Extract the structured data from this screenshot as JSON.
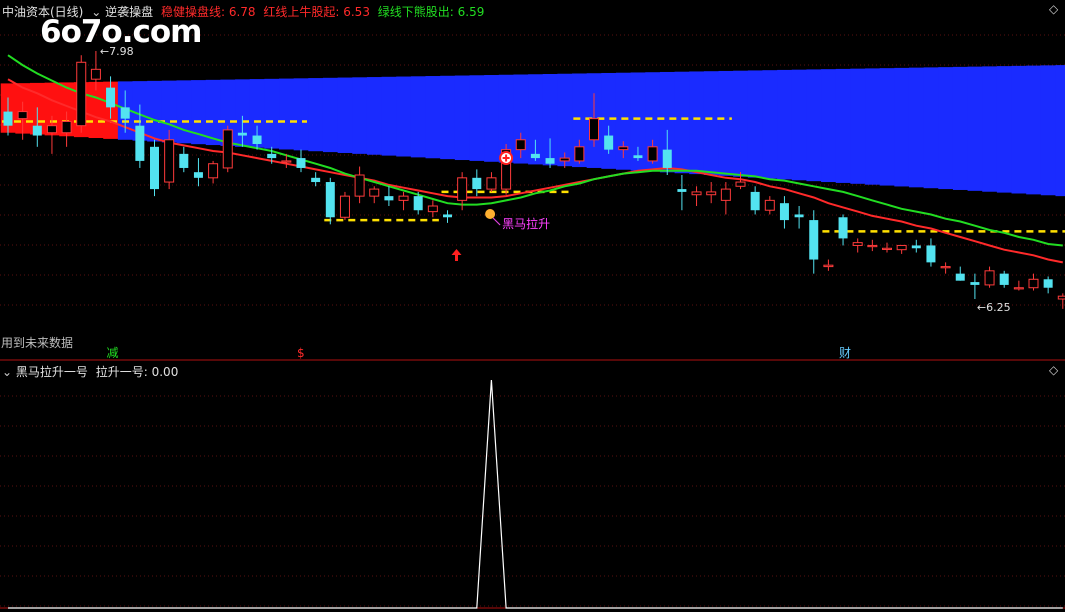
{
  "watermark": "6o7o.com",
  "main_panel": {
    "title": "中油资本(日线)",
    "indicator": "逆袭操盘",
    "lines": [
      {
        "label": "稳健操盘线:",
        "value": "6.78",
        "color": "#ff2a2a"
      },
      {
        "label": "红线上牛股起:",
        "value": "6.53",
        "color": "#ff2a2a"
      },
      {
        "label": "绿线下熊股出:",
        "value": "6.59",
        "color": "#22dd22"
      }
    ],
    "future_data_note": "用到未来数据",
    "marker_label": "黑马拉升",
    "high_label": "7.98",
    "low_label": "6.25",
    "badges": [
      {
        "text": "减",
        "color": "#22dd22"
      },
      {
        "text": "$",
        "color": "#ff2a2a"
      },
      {
        "text": "财",
        "color": "#66ccff"
      }
    ]
  },
  "sub_panel": {
    "indicator": "黑马拉升一号",
    "line_label": "拉升一号:",
    "line_value": "0.00"
  },
  "chart_data": {
    "type": "candlestick",
    "title": "中油资本(日线)",
    "price_range": [
      6.0,
      8.2
    ],
    "ohlc": [
      [
        7.55,
        7.65,
        7.38,
        7.45
      ],
      [
        7.5,
        7.62,
        7.35,
        7.55
      ],
      [
        7.45,
        7.58,
        7.3,
        7.38
      ],
      [
        7.4,
        7.52,
        7.25,
        7.45
      ],
      [
        7.4,
        7.55,
        7.3,
        7.48
      ],
      [
        7.45,
        7.95,
        7.4,
        7.9
      ],
      [
        7.78,
        7.98,
        7.7,
        7.85
      ],
      [
        7.72,
        7.8,
        7.5,
        7.58
      ],
      [
        7.58,
        7.7,
        7.4,
        7.5
      ],
      [
        7.45,
        7.6,
        7.15,
        7.2
      ],
      [
        7.3,
        7.35,
        6.95,
        7.0
      ],
      [
        7.05,
        7.42,
        7.0,
        7.35
      ],
      [
        7.25,
        7.3,
        7.12,
        7.15
      ],
      [
        7.12,
        7.22,
        7.02,
        7.08
      ],
      [
        7.08,
        7.2,
        7.04,
        7.18
      ],
      [
        7.15,
        7.45,
        7.12,
        7.42
      ],
      [
        7.4,
        7.52,
        7.3,
        7.38
      ],
      [
        7.38,
        7.45,
        7.28,
        7.32
      ],
      [
        7.25,
        7.3,
        7.18,
        7.22
      ],
      [
        7.2,
        7.25,
        7.15,
        7.2
      ],
      [
        7.22,
        7.28,
        7.12,
        7.15
      ],
      [
        7.08,
        7.12,
        7.02,
        7.05
      ],
      [
        7.05,
        7.08,
        6.75,
        6.8
      ],
      [
        6.8,
        6.98,
        6.78,
        6.95
      ],
      [
        6.95,
        7.16,
        6.9,
        7.1
      ],
      [
        6.95,
        7.02,
        6.9,
        7.0
      ],
      [
        6.95,
        7.02,
        6.88,
        6.92
      ],
      [
        6.92,
        6.98,
        6.85,
        6.95
      ],
      [
        6.95,
        6.98,
        6.82,
        6.85
      ],
      [
        6.84,
        6.92,
        6.8,
        6.88
      ],
      [
        6.82,
        6.85,
        6.76,
        6.8
      ],
      [
        6.92,
        7.12,
        6.85,
        7.08
      ],
      [
        7.08,
        7.14,
        6.95,
        7.0
      ],
      [
        7.0,
        7.12,
        6.98,
        7.08
      ],
      [
        7.0,
        7.32,
        6.96,
        7.28
      ],
      [
        7.28,
        7.4,
        7.22,
        7.35
      ],
      [
        7.25,
        7.35,
        7.2,
        7.22
      ],
      [
        7.22,
        7.36,
        7.15,
        7.18
      ],
      [
        7.2,
        7.26,
        7.15,
        7.22
      ],
      [
        7.2,
        7.35,
        7.18,
        7.3
      ],
      [
        7.35,
        7.68,
        7.3,
        7.5
      ],
      [
        7.38,
        7.45,
        7.25,
        7.28
      ],
      [
        7.28,
        7.34,
        7.22,
        7.3
      ],
      [
        7.24,
        7.3,
        7.2,
        7.22
      ],
      [
        7.2,
        7.35,
        7.18,
        7.3
      ],
      [
        7.28,
        7.42,
        7.1,
        7.15
      ],
      [
        7.0,
        7.1,
        6.85,
        6.98
      ],
      [
        6.96,
        7.02,
        6.88,
        6.98
      ],
      [
        6.96,
        7.05,
        6.9,
        6.98
      ],
      [
        6.92,
        7.05,
        6.82,
        7.0
      ],
      [
        7.02,
        7.12,
        7.0,
        7.05
      ],
      [
        6.98,
        7.02,
        6.82,
        6.85
      ],
      [
        6.85,
        6.95,
        6.82,
        6.92
      ],
      [
        6.9,
        6.95,
        6.72,
        6.78
      ],
      [
        6.82,
        6.88,
        6.72,
        6.8
      ],
      [
        6.78,
        6.85,
        6.4,
        6.5
      ],
      [
        6.45,
        6.5,
        6.42,
        6.46
      ],
      [
        6.8,
        6.82,
        6.6,
        6.65
      ],
      [
        6.6,
        6.65,
        6.55,
        6.62
      ],
      [
        6.6,
        6.64,
        6.56,
        6.6
      ],
      [
        6.58,
        6.62,
        6.55,
        6.58
      ],
      [
        6.57,
        6.6,
        6.54,
        6.6
      ],
      [
        6.6,
        6.64,
        6.55,
        6.58
      ],
      [
        6.6,
        6.65,
        6.45,
        6.48
      ],
      [
        6.45,
        6.48,
        6.4,
        6.45
      ],
      [
        6.4,
        6.45,
        6.35,
        6.35
      ],
      [
        6.34,
        6.4,
        6.22,
        6.32
      ],
      [
        6.32,
        6.45,
        6.3,
        6.42
      ],
      [
        6.4,
        6.42,
        6.3,
        6.32
      ],
      [
        6.3,
        6.35,
        6.28,
        6.3
      ],
      [
        6.3,
        6.4,
        6.28,
        6.36
      ],
      [
        6.36,
        6.38,
        6.26,
        6.3
      ],
      [
        6.22,
        6.26,
        6.15,
        6.24
      ]
    ],
    "series": [
      {
        "name": "稳健操盘线",
        "color": "#ff2a2a",
        "values": [
          7.78,
          7.72,
          7.68,
          7.63,
          7.59,
          7.55,
          7.51,
          7.48,
          7.44,
          7.4,
          7.36,
          7.33,
          7.31,
          7.29,
          7.27,
          7.26,
          7.24,
          7.22,
          7.2,
          7.18,
          7.16,
          7.14,
          7.12,
          7.1,
          7.08,
          7.06,
          7.03,
          7.01,
          6.99,
          6.97,
          6.95,
          6.94,
          6.94,
          6.94,
          6.95,
          6.97,
          6.99,
          7.01,
          7.03,
          7.05,
          7.07,
          7.09,
          7.11,
          7.13,
          7.14,
          7.15,
          7.14,
          7.12,
          7.1,
          7.08,
          7.07,
          7.05,
          7.02,
          7.0,
          6.97,
          6.94,
          6.9,
          6.87,
          6.84,
          6.81,
          6.79,
          6.77,
          6.74,
          6.72,
          6.69,
          6.66,
          6.63,
          6.6,
          6.57,
          6.55,
          6.53,
          6.5,
          6.48
        ]
      },
      {
        "name": "绿线下熊股出",
        "color": "#22dd22",
        "values": [
          7.95,
          7.88,
          7.82,
          7.77,
          7.72,
          7.68,
          7.65,
          7.61,
          7.57,
          7.53,
          7.49,
          7.46,
          7.42,
          7.39,
          7.36,
          7.33,
          7.31,
          7.29,
          7.27,
          7.24,
          7.21,
          7.18,
          7.15,
          7.11,
          7.08,
          7.05,
          7.02,
          6.99,
          6.96,
          6.93,
          6.9,
          6.89,
          6.89,
          6.9,
          6.92,
          6.94,
          6.97,
          6.99,
          7.02,
          7.04,
          7.07,
          7.09,
          7.11,
          7.12,
          7.13,
          7.13,
          7.13,
          7.13,
          7.12,
          7.11,
          7.1,
          7.09,
          7.07,
          7.06,
          7.04,
          7.02,
          7.0,
          6.98,
          6.95,
          6.92,
          6.89,
          6.86,
          6.84,
          6.82,
          6.79,
          6.77,
          6.74,
          6.71,
          6.69,
          6.66,
          6.64,
          6.61,
          6.6
        ]
      }
    ],
    "support_levels": [
      {
        "from": 0,
        "to": 20,
        "price": 7.48
      },
      {
        "from": 22,
        "to": 29,
        "price": 6.78
      },
      {
        "from": 30,
        "to": 38,
        "price": 6.98
      },
      {
        "from": 39,
        "to": 49,
        "price": 7.5
      },
      {
        "from": 56,
        "to": 72,
        "price": 6.7
      }
    ],
    "band": {
      "upper": [
        7.75,
        7.88
      ],
      "lower": [
        7.4,
        6.95
      ],
      "red_until": 8
    },
    "signal_index": 34,
    "arrow_index": 30,
    "sub_series": {
      "name": "拉升一号",
      "values": [
        0,
        0,
        0,
        0,
        0,
        0,
        0,
        0,
        0,
        0,
        0,
        0,
        0,
        0,
        0,
        0,
        0,
        0,
        0,
        0,
        0,
        0,
        0,
        0,
        0,
        0,
        0,
        0,
        0,
        0,
        0,
        0,
        0,
        1,
        0,
        0,
        0,
        0,
        0,
        0,
        0,
        0,
        0,
        0,
        0,
        0,
        0,
        0,
        0,
        0,
        0,
        0,
        0,
        0,
        0,
        0,
        0,
        0,
        0,
        0,
        0,
        0,
        0,
        0,
        0,
        0,
        0,
        0,
        0,
        0,
        0,
        0,
        0
      ]
    }
  }
}
